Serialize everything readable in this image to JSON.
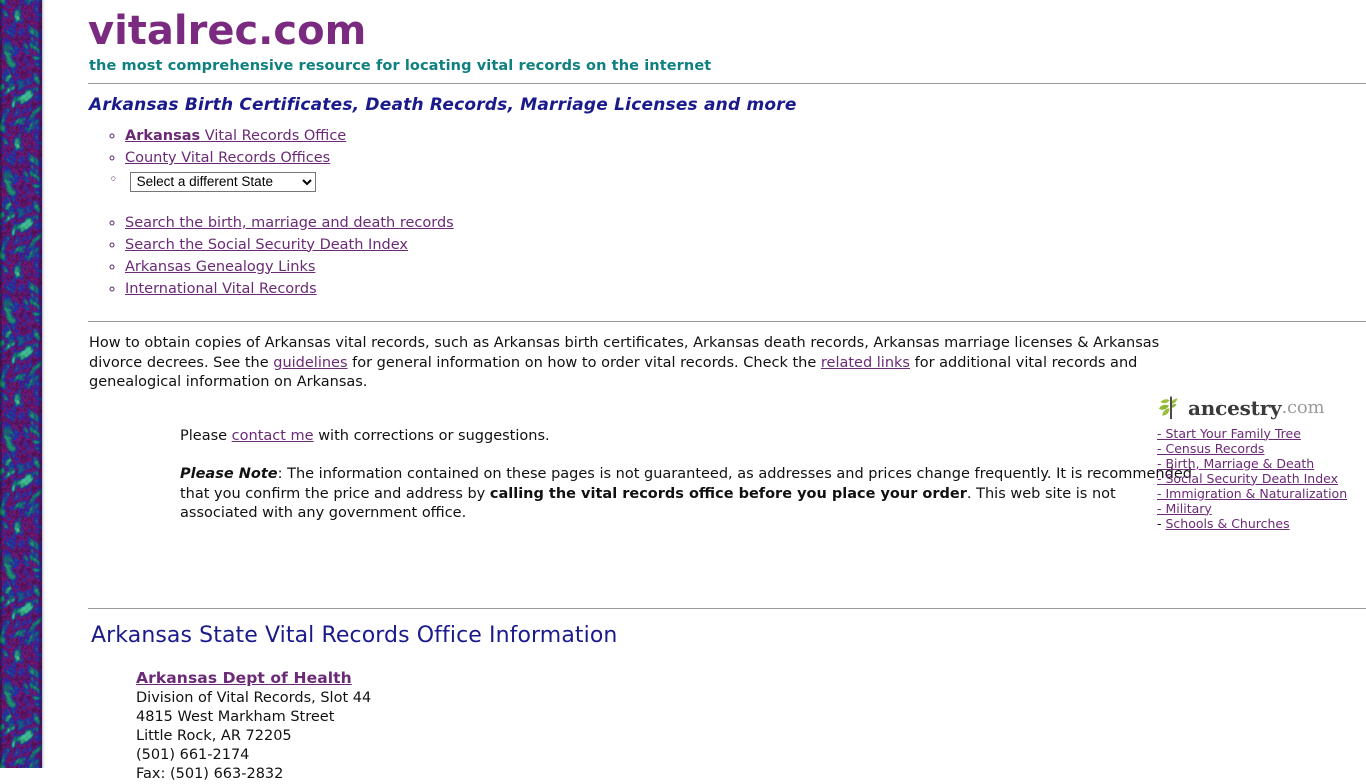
{
  "site": {
    "title": "vitalrec.com",
    "tagline": "the most comprehensive resource for locating vital records on the internet"
  },
  "page_heading": "Arkansas Birth Certificates, Death Records, Marriage Licenses and more",
  "nav_primary": [
    {
      "bold": "Arkansas",
      "rest": " Vital Records Office"
    },
    {
      "bold": "",
      "rest": "County Vital Records Offices"
    }
  ],
  "state_select": {
    "selected": "Select a different State",
    "options": [
      "Select a different State"
    ]
  },
  "nav_secondary": [
    "Search the birth, marriage and death records",
    "Search the Social Security Death Index",
    "Arkansas Genealogy Links",
    "International Vital Records"
  ],
  "intro": {
    "part1": "How to obtain copies of Arkansas vital records, such as Arkansas birth certificates, Arkansas death records, Arkansas marriage licenses & Arkansas divorce decrees. See the ",
    "link1": "guidelines",
    "part2": " for general information on how to order vital records. Check the ",
    "link2": "related links",
    "part3": " for additional vital records and genealogical information on Arkansas."
  },
  "contact": {
    "pre": "Please ",
    "link": "contact me",
    "post": " with corrections or suggestions."
  },
  "note": {
    "label": "Please Note",
    "colon": ": ",
    "part1": "The information contained on these pages is not guaranteed, as addresses and prices change frequently. It is recommended that you confirm the price and address by ",
    "bold": "calling the vital records office before you place your order",
    "part2": ". This web site is not associated with any government office."
  },
  "ancestry": {
    "logo_name": "ancestry",
    "logo_suffix": ".com",
    "links": [
      "Start Your Family Tree",
      "Census Records",
      "Birth, Marriage & Death",
      "Social Security Death Index",
      "Immigration & Naturalization",
      "Military",
      "Schools & Churches"
    ],
    "dash": "- "
  },
  "office": {
    "heading": "Arkansas State Vital Records Office Information",
    "name": "Arkansas Dept of Health",
    "lines": [
      "Division of Vital Records, Slot 44",
      "4815 West Markham Street",
      "Little Rock, AR 72205",
      "(501) 661-2174",
      "Fax: (501) 663-2832"
    ]
  },
  "colors": {
    "title_purple": "#7a2a7f",
    "tagline_teal": "#0f8080",
    "heading_navy": "#1a1a8c",
    "link_purple": "#6a2a76",
    "ancestry_leaf_green": "#9cbf3b",
    "rule_gray": "#9a9a9a"
  }
}
